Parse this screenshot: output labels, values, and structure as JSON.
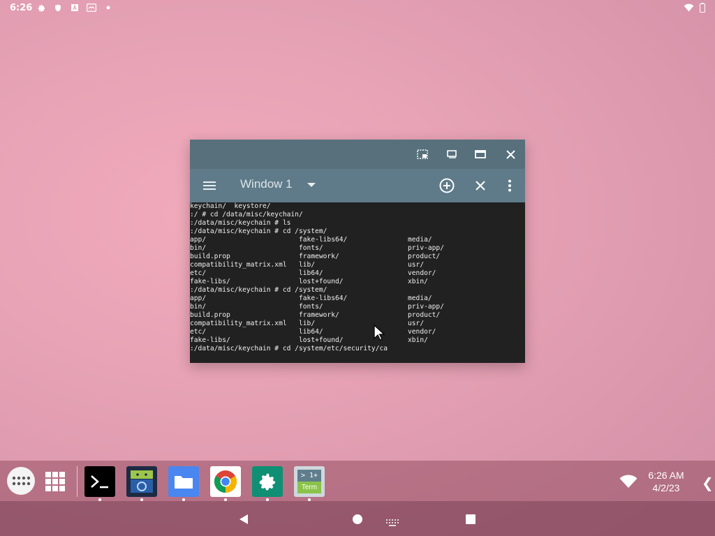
{
  "status_bar": {
    "time": "6:26",
    "icons": [
      "gear-icon",
      "shield-icon",
      "font-a-icon",
      "screenshot-icon",
      "dot-icon"
    ]
  },
  "window": {
    "caption_buttons": [
      "pip-icon",
      "restore-icon",
      "maximize-icon",
      "close-icon"
    ],
    "toolbar": {
      "title": "Window 1",
      "actions": [
        "add-circle-icon",
        "close-window-icon",
        "more-vert-icon"
      ]
    },
    "terminal_lines": [
      [
        "keychain/  keystore/",
        "",
        ""
      ],
      [
        ":/ # cd /data/misc/keychain/",
        "",
        ""
      ],
      [
        ":/data/misc/keychain # ls",
        "",
        ""
      ],
      [
        ":/data/misc/keychain # cd /system/",
        "",
        ""
      ],
      [
        "app/",
        "fake-libs64/",
        "media/"
      ],
      [
        "bin/",
        "fonts/",
        "priv-app/"
      ],
      [
        "build.prop",
        "framework/",
        "product/"
      ],
      [
        "compatibility_matrix.xml",
        "lib/",
        "usr/"
      ],
      [
        "etc/",
        "lib64/",
        "vendor/"
      ],
      [
        "fake-libs/",
        "lost+found/",
        "xbin/"
      ],
      [
        ":/data/misc/keychain # cd /system/",
        "",
        ""
      ],
      [
        "app/",
        "fake-libs64/",
        "media/"
      ],
      [
        "bin/",
        "fonts/",
        "priv-app/"
      ],
      [
        "build.prop",
        "framework/",
        "product/"
      ],
      [
        "compatibility_matrix.xml",
        "lib/",
        "usr/"
      ],
      [
        "etc/",
        "lib64/",
        "vendor/"
      ],
      [
        "fake-libs/",
        "lost+found/",
        "xbin/"
      ],
      [
        ":/data/misc/keychain # cd /system/etc/security/ca",
        "",
        ""
      ]
    ]
  },
  "taskbar": {
    "apps": [
      {
        "name": "terminal-app",
        "label": "Terminal"
      },
      {
        "name": "android-app",
        "label": "Android"
      },
      {
        "name": "files-app",
        "label": "Files"
      },
      {
        "name": "chrome-app",
        "label": "Chrome"
      },
      {
        "name": "settings-app",
        "label": "Settings"
      },
      {
        "name": "term-app",
        "label": "Term",
        "badge": "> 1+"
      }
    ],
    "clock_time": "6:26 AM",
    "clock_date": "4/2/23",
    "chevron": "❮"
  },
  "colors": {
    "caption": "#57707c",
    "toolbar": "#5f7b89",
    "terminal_bg": "#212121",
    "settings": "#0f8f73",
    "files": "#4a86f0"
  }
}
